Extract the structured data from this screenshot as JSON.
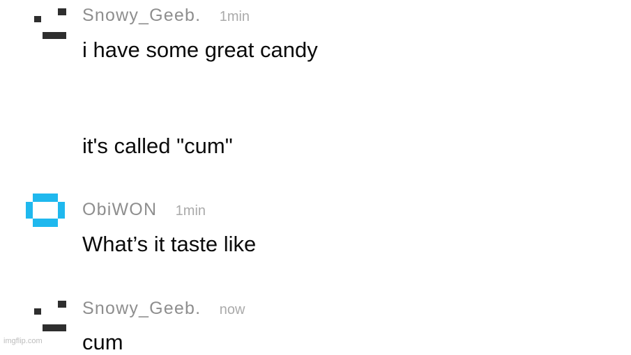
{
  "comments": [
    {
      "username": "Snowy_Geeb.",
      "timestamp": "1min",
      "avatar_icon": "pixel-face-icon",
      "avatar_color": "#2e2e2e",
      "lines": [
        "i have some great candy",
        "it's called \"cum\""
      ]
    },
    {
      "username": "ObiWON",
      "timestamp": "1min",
      "avatar_icon": "pixel-ring-icon",
      "avatar_color": "#1fb8ee",
      "lines": [
        "What’s it taste like"
      ]
    },
    {
      "username": "Snowy_Geeb.",
      "timestamp": "now",
      "avatar_icon": "pixel-face-icon",
      "avatar_color": "#2e2e2e",
      "lines": [
        "cum"
      ]
    }
  ],
  "watermark": "imgflip.com"
}
